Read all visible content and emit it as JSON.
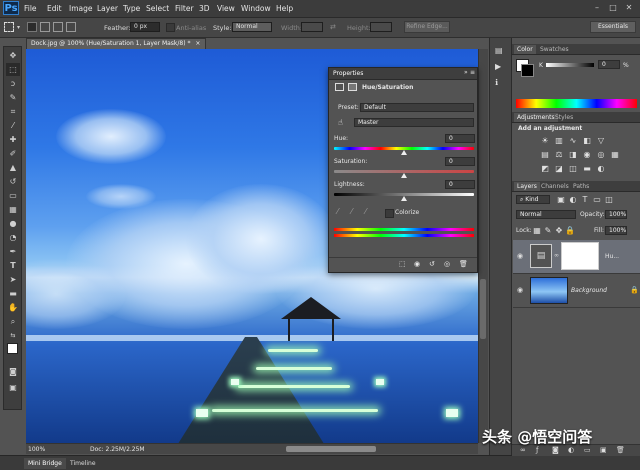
{
  "app": {
    "logo": "Ps"
  },
  "menu": [
    "File",
    "Edit",
    "Image",
    "Layer",
    "Type",
    "Select",
    "Filter",
    "3D",
    "View",
    "Window",
    "Help"
  ],
  "window_controls": [
    "–",
    "□",
    "✕"
  ],
  "options": {
    "feather_label": "Feather:",
    "feather_value": "0 px",
    "antialias_label": "Anti-alias",
    "style_label": "Style:",
    "style_value": "Normal",
    "width_label": "Width:",
    "height_label": "Height:",
    "refine_label": "Refine Edge...",
    "workspace": "Essentials"
  },
  "document": {
    "tab_title": "Dock.jpg @ 100% (Hue/Saturation 1, Layer Mask/8) *",
    "close": "×",
    "zoom": "100%",
    "doc_size": "Doc: 2.25M/2.25M"
  },
  "bottom_tabs": [
    "Mini Bridge",
    "Timeline"
  ],
  "properties": {
    "panel_title": "Properties",
    "adjustment_name": "Hue/Saturation",
    "preset_label": "Preset:",
    "preset_value": "Default",
    "channel_value": "Master",
    "hue_label": "Hue:",
    "hue_value": "0",
    "saturation_label": "Saturation:",
    "saturation_value": "0",
    "lightness_label": "Lightness:",
    "lightness_value": "0",
    "colorize_label": "Colorize"
  },
  "color_panel": {
    "tabs": [
      "Color",
      "Swatches"
    ],
    "k_label": "K",
    "k_value": "0",
    "pct": "%"
  },
  "adjustments_panel": {
    "tabs": [
      "Adjustments",
      "Styles"
    ],
    "heading": "Add an adjustment"
  },
  "layers_panel": {
    "tabs": [
      "Layers",
      "Channels",
      "Paths"
    ],
    "kind": "Kind",
    "blend_mode": "Normal",
    "opacity_label": "Opacity:",
    "opacity_value": "100%",
    "lock_label": "Lock:",
    "fill_label": "Fill:",
    "fill_value": "100%",
    "layers": [
      {
        "name": "Hu..."
      },
      {
        "name": "Background"
      }
    ]
  },
  "watermark": "头条 @悟空问答",
  "colors": {
    "ui_dark": "#3c3c3c",
    "panel": "#535353",
    "accent_blue": "#2f7fd0"
  }
}
